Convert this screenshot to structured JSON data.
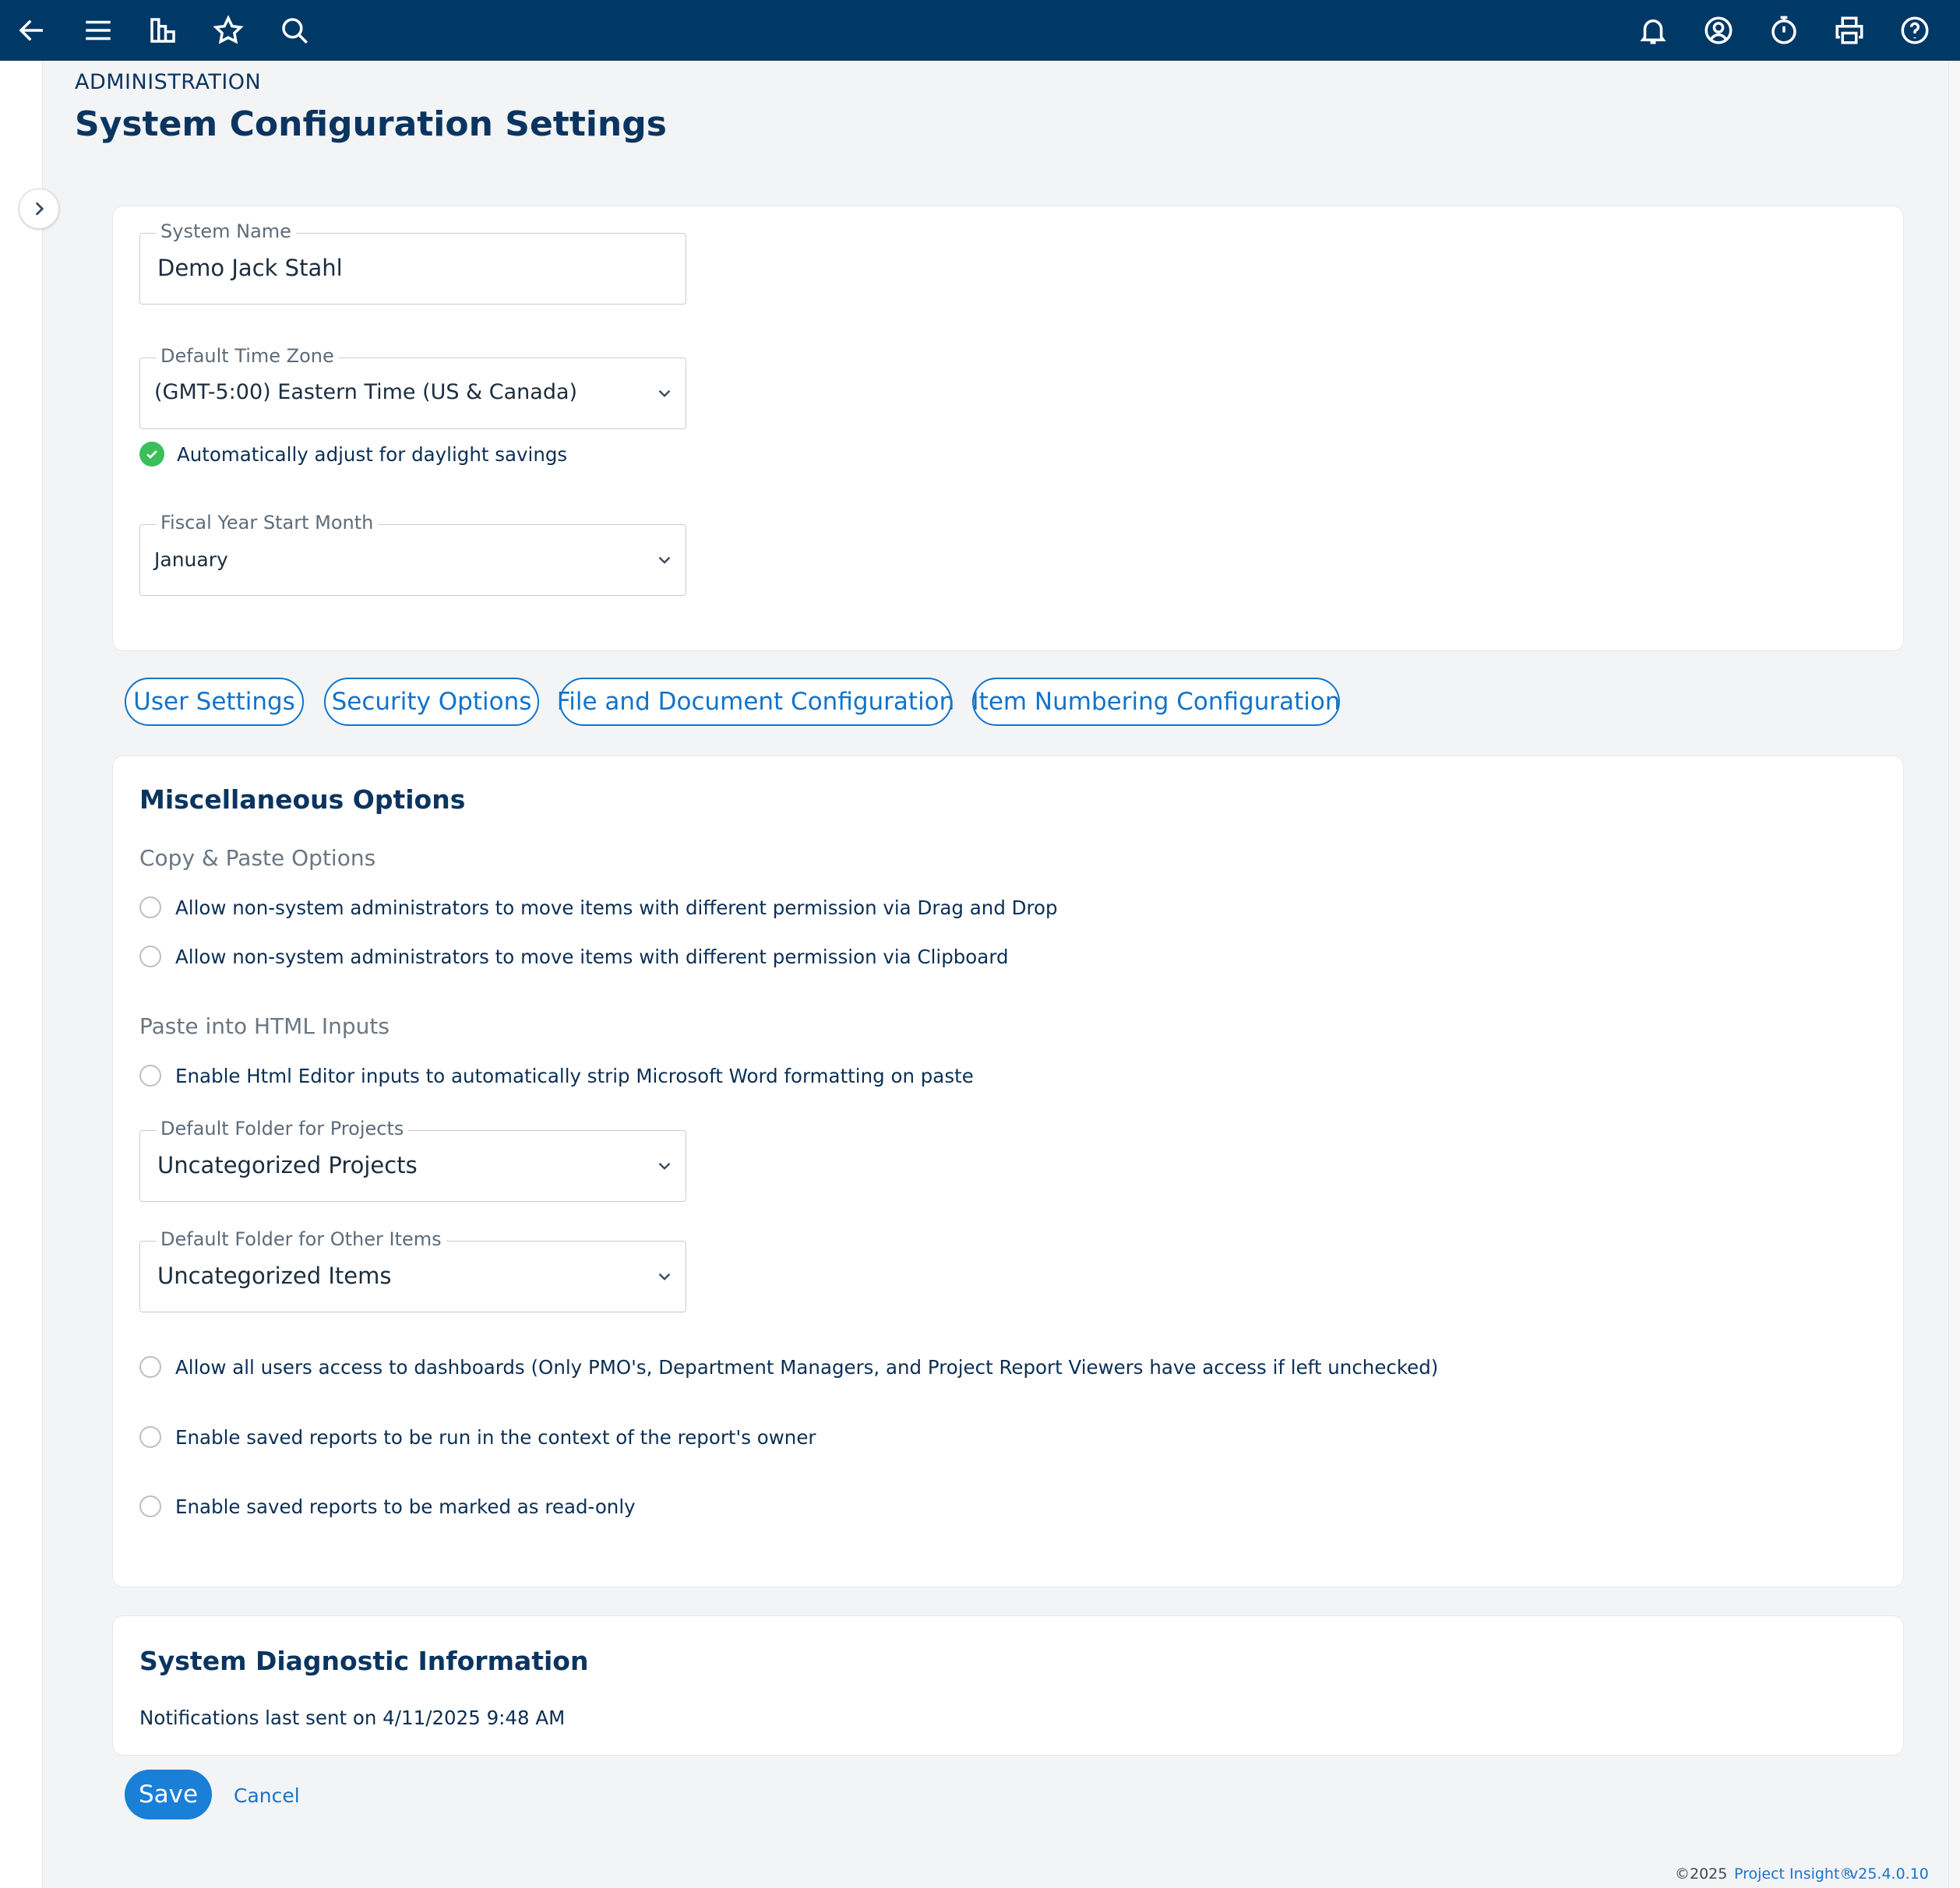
{
  "topbar": {
    "left_icons": [
      "back-arrow-icon",
      "menu-icon",
      "dashboard-icon",
      "star-icon",
      "search-icon"
    ],
    "right_icons": [
      "bell-icon",
      "user-circle-icon",
      "timer-icon",
      "printer-icon",
      "help-icon"
    ],
    "background": "#003866"
  },
  "header": {
    "breadcrumb": "ADMINISTRATION",
    "title": "System Configuration Settings"
  },
  "general": {
    "system_name": {
      "label": "System Name",
      "value": "Demo Jack Stahl"
    },
    "time_zone": {
      "label": "Default Time Zone",
      "value": "(GMT-5:00) Eastern Time (US & Canada)"
    },
    "daylight_savings": {
      "label": "Automatically adjust for daylight savings",
      "checked": true
    },
    "fiscal_year": {
      "label": "Fiscal Year Start Month",
      "value": "January"
    }
  },
  "tabs": [
    {
      "label": "User Settings"
    },
    {
      "label": "Security Options"
    },
    {
      "label": "File and Document Configuration"
    },
    {
      "label": "Item Numbering Configuration"
    }
  ],
  "misc": {
    "title": "Miscellaneous Options",
    "copy_paste": {
      "title": "Copy & Paste Options",
      "options": [
        "Allow non-system administrators to move items with different permission via Drag and Drop",
        "Allow non-system administrators to move items with different permission via Clipboard"
      ]
    },
    "paste_html": {
      "title": "Paste into HTML Inputs",
      "option": "Enable Html Editor inputs to automatically strip Microsoft Word formatting on paste"
    },
    "default_folder_projects": {
      "label": "Default Folder for Projects",
      "value": "Uncategorized Projects"
    },
    "default_folder_other": {
      "label": "Default Folder for Other Items",
      "value": "Uncategorized Items"
    },
    "options": [
      "Allow all users access to dashboards (Only PMO's, Department Managers, and Project Report Viewers have access if left unchecked)",
      "Enable saved reports to be run in the context of the report's owner",
      "Enable saved reports to be marked as read-only"
    ]
  },
  "diagnostic": {
    "title": "System Diagnostic Information",
    "notifications": "Notifications last sent on 4/11/2025 9:48 AM"
  },
  "actions": {
    "save": "Save",
    "cancel": "Cancel"
  },
  "footer": {
    "copyright": "©2025",
    "brand": "Project Insight®",
    "version": "v25.4.0.10"
  },
  "colors": {
    "accent": "#1273c9",
    "check": "#3cbf5a",
    "title": "#0b3560"
  }
}
